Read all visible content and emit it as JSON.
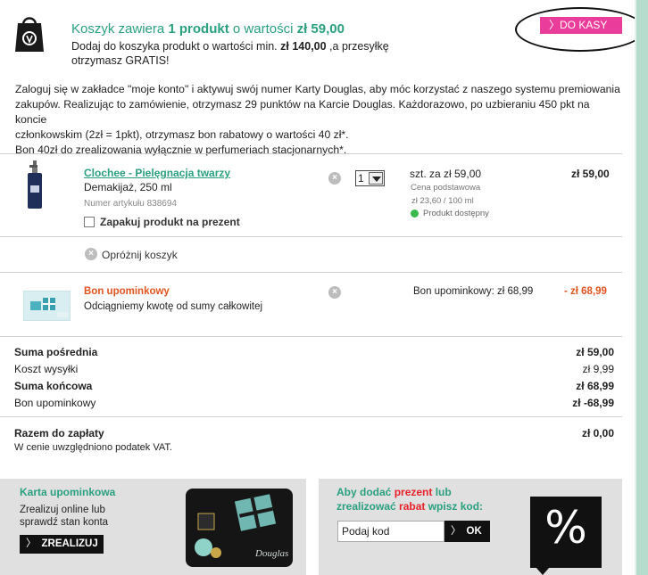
{
  "header": {
    "title_prefix": "Koszyk zawiera ",
    "title_count": "1 produkt",
    "title_mid": " o wartości ",
    "title_value": "zł 59,00",
    "sub_line1_a": "Dodaj do koszyka produkt o wartości min. ",
    "sub_line1_b": "zł 140,00",
    "sub_line1_c": " ,a przesyłkę",
    "sub_line2": "otrzymasz GRATIS!",
    "checkout_label": "DO KASY"
  },
  "info": {
    "line1": "Zaloguj się w zakładce \"moje konto\" i aktywuj swój numer Karty Douglas, aby móc korzystać z naszego systemu premiowania",
    "line2": "zakupów. Realizując to zamówienie, otrzymasz 29 punktów na Karcie Douglas. Każdorazowo, po uzbieraniu 450 pkt na koncie",
    "line3": "członkowskim (2zł = 1pkt), otrzymasz bon rabatowy o wartości 40 zł*.",
    "line4": "Bon 40zł do zrealizowania wyłącznie w perfumeriach stacjonarnych*."
  },
  "product": {
    "name": "Clochee - Pielęgnacja twarzy",
    "desc": "Demakijaż, 250 ml",
    "article": "Numer artykułu 838694",
    "gift_wrap_label": "Zapakuj produkt na prezent",
    "remove_icon": "×",
    "quantity": "1",
    "unit_price": "szt. za zł 59,00",
    "base_price_label": "Cena podstawowa",
    "per_unit": "zł 23,60 / 100 ml",
    "availability": "Produkt dostępny",
    "availability_color": "#3cb94d",
    "total": "zł 59,00"
  },
  "empty_cart": {
    "icon": "×",
    "label": "Opróżnij koszyk"
  },
  "voucher": {
    "name": "Bon upominkowy",
    "desc": "Odciągniemy kwotę od sumy całkowitej",
    "remove_icon": "×",
    "mid_label": "Bon upominkowy: zł 68,99",
    "amount": "- zł 68,99"
  },
  "summary": {
    "subtotal_label": "Suma pośrednia",
    "subtotal_value": "zł 59,00",
    "shipping_label": "Koszt wysyłki",
    "shipping_value": "zł 9,99",
    "total_label": "Suma końcowa",
    "total_value": "zł 68,99",
    "voucher_label": "Bon upominkowy",
    "voucher_value": "zł -68,99",
    "pay_label": "Razem do zapłaty",
    "pay_value": "zł 0,00",
    "vat_note": "W cenie uwzględniono podatek VAT."
  },
  "gift_card_panel": {
    "title": "Karta upominkowa",
    "sub_line1": "Zrealizuj online lub",
    "sub_line2": "sprawdź stan konta",
    "button_arrow": "〉",
    "button_label": "ZREALIZUJ",
    "card_brand": "Douglas"
  },
  "promo_panel": {
    "title_a": "Aby dodać ",
    "title_b": "prezent",
    "title_c": " lub",
    "title_d": "zrealizować ",
    "title_e": "rabat",
    "title_f": " wpisz kod:",
    "input_value": "Podaj kod",
    "ok_arrow": "〉",
    "ok_label": "OK",
    "percent_symbol": "%"
  },
  "colors": {
    "accent_green": "#2aa07f",
    "checkout_pink": "#ea3c9a",
    "voucher_orange": "#e2541f",
    "promo_red": "#e8212a"
  }
}
